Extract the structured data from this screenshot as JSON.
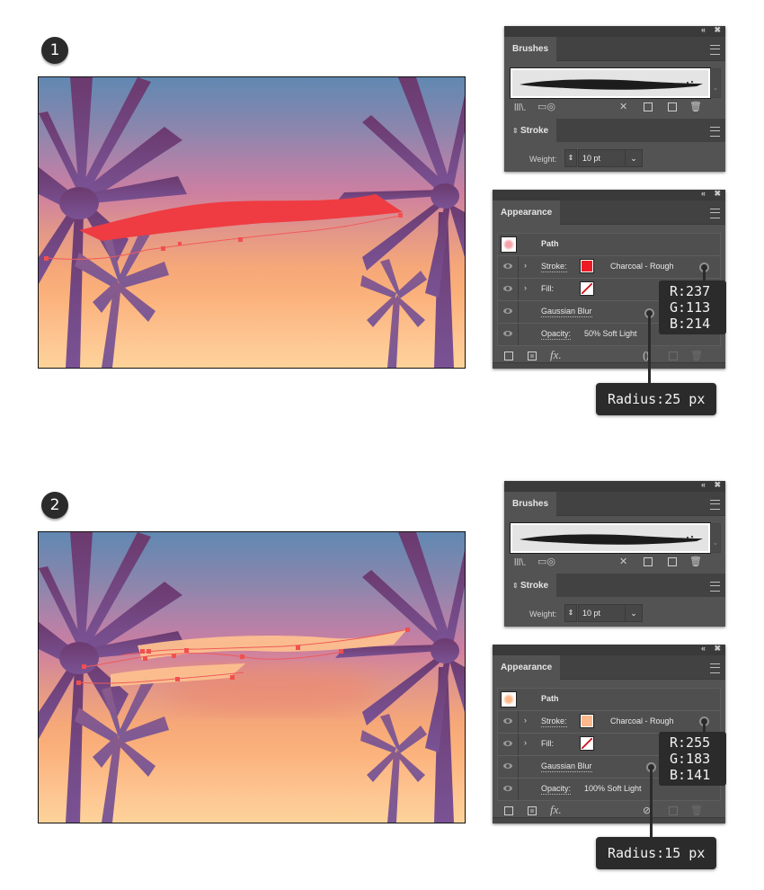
{
  "steps": [
    {
      "number": "1",
      "artboard": {
        "stroke_color": "#ee3c42",
        "stroke_opacity": 1.0,
        "blur_glow_color": "#ee7a72"
      },
      "brushes_panel": {
        "collapse_label": "«",
        "close_label": "✖",
        "tab_label": "Brushes",
        "icons": [
          "brush-libraries-icon",
          "cloud-libraries-icon",
          "remove-stroke-icon",
          "brush-options-icon",
          "new-brush-icon",
          "delete-brush-icon"
        ]
      },
      "stroke_panel": {
        "tab_label": "Stroke",
        "weight_label": "Weight:",
        "weight_value": "10 pt"
      },
      "appearance_panel": {
        "tab_label": "Appearance",
        "object_label": "Path",
        "thumbnail_color": "#f5a3a8",
        "rows": [
          {
            "label": "Stroke:",
            "value": "Charcoal - Rough",
            "swatch": "#ed1c24",
            "expandable": true
          },
          {
            "label": "Fill:",
            "value": "",
            "swatch": "none",
            "expandable": true
          },
          {
            "label": "Gaussian Blur",
            "value": "",
            "expandable": false
          },
          {
            "label": "Opacity:",
            "value": "50% Soft Light",
            "expandable": false
          }
        ]
      },
      "callout_rgb": {
        "r": "R:237",
        "g": "G:113",
        "b": "B:214"
      },
      "callout_radius": "Radius:25 px"
    },
    {
      "number": "2",
      "artboard": {
        "stroke_color": "#fdc08f",
        "stroke_opacity": 1.0,
        "blur_glow_color": "#ec8a70"
      },
      "brushes_panel": {
        "collapse_label": "«",
        "close_label": "✖",
        "tab_label": "Brushes",
        "icons": [
          "brush-libraries-icon",
          "cloud-libraries-icon",
          "remove-stroke-icon",
          "brush-options-icon",
          "new-brush-icon",
          "delete-brush-icon"
        ]
      },
      "stroke_panel": {
        "tab_label": "Stroke",
        "weight_label": "Weight:",
        "weight_value": "10 pt"
      },
      "appearance_panel": {
        "tab_label": "Appearance",
        "object_label": "Path",
        "thumbnail_color": "#fbb98a",
        "rows": [
          {
            "label": "Stroke:",
            "value": "Charcoal - Rough",
            "swatch": "#ffb78d",
            "expandable": true
          },
          {
            "label": "Fill:",
            "value": "",
            "swatch": "none",
            "expandable": true
          },
          {
            "label": "Gaussian Blur",
            "value": "",
            "expandable": false
          },
          {
            "label": "Opacity:",
            "value": "100% Soft Light",
            "expandable": false
          }
        ]
      },
      "callout_rgb": {
        "r": "R:255",
        "g": "G:183",
        "b": "B:141"
      },
      "callout_radius": "Radius:15 px"
    }
  ]
}
